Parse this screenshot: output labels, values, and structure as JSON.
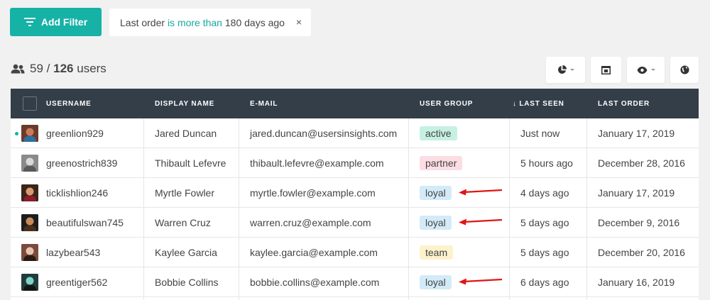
{
  "filter_bar": {
    "add_filter_label": "Add Filter",
    "chip": {
      "prefix": "Last order",
      "operator": "is more than",
      "value": "180 days ago",
      "close": "×"
    }
  },
  "summary": {
    "filtered": "59",
    "separator": "/",
    "total": "126",
    "suffix": "users"
  },
  "toolbar": {
    "buttons": [
      {
        "icon": "pie-chart-icon",
        "has_caret": true
      },
      {
        "icon": "column-layout-icon",
        "has_caret": false
      },
      {
        "icon": "eye-icon",
        "has_caret": true
      },
      {
        "icon": "globe-icon",
        "has_caret": false
      }
    ]
  },
  "table": {
    "columns": [
      "USERNAME",
      "DISPLAY NAME",
      "E-MAIL",
      "USER GROUP",
      "↓ LAST SEEN",
      "LAST ORDER"
    ],
    "rows": [
      {
        "username": "greenlion929",
        "display_name": "Jared Duncan",
        "email": "jared.duncan@usersinsights.com",
        "group": "active",
        "last_seen": "Just now",
        "last_order": "January 17, 2019",
        "online": true,
        "arrow": false
      },
      {
        "username": "greenostrich839",
        "display_name": "Thibault Lefevre",
        "email": "thibault.lefevre@example.com",
        "group": "partner",
        "last_seen": "5 hours ago",
        "last_order": "December 28, 2016",
        "online": false,
        "arrow": false
      },
      {
        "username": "ticklishlion246",
        "display_name": "Myrtle Fowler",
        "email": "myrtle.fowler@example.com",
        "group": "loyal",
        "last_seen": "4 days ago",
        "last_order": "January 17, 2019",
        "online": false,
        "arrow": true
      },
      {
        "username": "beautifulswan745",
        "display_name": "Warren Cruz",
        "email": "warren.cruz@example.com",
        "group": "loyal",
        "last_seen": "5 days ago",
        "last_order": "December 9, 2016",
        "online": false,
        "arrow": true
      },
      {
        "username": "lazybear543",
        "display_name": "Kaylee Garcia",
        "email": "kaylee.garcia@example.com",
        "group": "team",
        "last_seen": "5 days ago",
        "last_order": "December 20, 2016",
        "online": false,
        "arrow": false
      },
      {
        "username": "greentiger562",
        "display_name": "Bobbie Collins",
        "email": "bobbie.collins@example.com",
        "group": "loyal",
        "last_seen": "6 days ago",
        "last_order": "January 16, 2019",
        "online": false,
        "arrow": true
      }
    ]
  },
  "colors": {
    "accent": "#16b2a6",
    "header_bg": "#333e49",
    "tag_active_bg": "#c6f0e2",
    "tag_partner_bg": "#fcdde4",
    "tag_loyal_bg": "#d3ebf8",
    "tag_team_bg": "#fdf2cc",
    "annotation_arrow": "#e01515"
  }
}
